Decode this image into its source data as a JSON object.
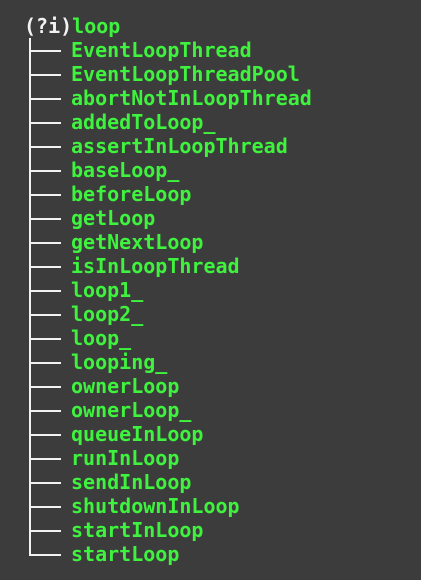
{
  "root": {
    "prefix": "(?i)",
    "word": "loop"
  },
  "items": [
    "EventLoopThread",
    "EventLoopThreadPool",
    "abortNotInLoopThread",
    "addedToLoop_",
    "assertInLoopThread",
    "baseLoop_",
    "beforeLoop",
    "getLoop",
    "getNextLoop",
    "isInLoopThread",
    "loop1_",
    "loop2_",
    "loop_",
    "looping_",
    "ownerLoop",
    "ownerLoop_",
    "queueInLoop",
    "runInLoop",
    "sendInLoop",
    "shutdownInLoop",
    "startInLoop",
    "startLoop"
  ],
  "colors": {
    "background": "#3c3c3c",
    "match_text": "#3ef23e",
    "tree_lines": "#f2f2f2"
  }
}
